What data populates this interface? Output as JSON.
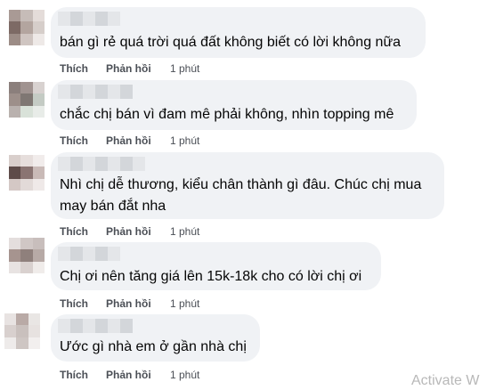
{
  "comments": [
    {
      "author_name": "",
      "text_lines": [
        "bán gì rẻ quá trời quá đất không biết có lời không nữa"
      ],
      "like_label": "Thích",
      "reply_label": "Phản hồi",
      "timestamp": "1 phút",
      "avatar_colors": [
        "#a99a95",
        "#c6bcb8",
        "#e4dcd9",
        "#7d6a65",
        "#b3a59f",
        "#d6ceca",
        "#9c8c86",
        "#cfc5c1",
        "#eee9e7"
      ]
    },
    {
      "author_name": "",
      "text_lines": [
        "chắc chị bán vì đam mê phải không, nhìn topping mê"
      ],
      "like_label": "Thích",
      "reply_label": "Phản hồi",
      "timestamp": "1 phút",
      "avatar_colors": [
        "#8b7f7c",
        "#a09390",
        "#d8d2d0",
        "#9d8f8a",
        "#7f7773",
        "#c4cbc4",
        "#b9b1ae",
        "#d9e2d9",
        "#e8ece8"
      ]
    },
    {
      "author_name": "",
      "text_lines": [
        "Nhì chị dễ thương, kiểu chân thành gì đâu. Chúc chị mua",
        "may bán đắt nha"
      ],
      "like_label": "Thích",
      "reply_label": "Phản hồi",
      "timestamp": "1 phút",
      "avatar_colors": [
        "#d9cfcc",
        "#e6dedc",
        "#f1eceb",
        "#5e4b49",
        "#8a7472",
        "#c9bab7",
        "#d4c8c5",
        "#e2dad8",
        "#efe9e8"
      ]
    },
    {
      "author_name": "",
      "text_lines": [
        "Chị ơi nên tăng giá lên 15k-18k cho có lời chị ơi"
      ],
      "like_label": "Thích",
      "reply_label": "Phản hồi",
      "timestamp": "1 phút",
      "avatar_colors": [
        "#e4dedd",
        "#d0c7c5",
        "#c8bebc",
        "#a6948f",
        "#8f807c",
        "#b7aaa6",
        "#e8e3e2",
        "#d9d1cf",
        "#f0ecea"
      ]
    },
    {
      "author_name": "",
      "text_lines": [
        "Ước gì nhà em ở gần nhà chị"
      ],
      "like_label": "Thích",
      "reply_label": "Phản hồi",
      "timestamp": "1 phút",
      "avatar_colors": [
        "#e8e3e2",
        "#b9aaa6",
        "#e9e6e4",
        "#d8d0ce",
        "#c9c0bd",
        "#e7e2e0",
        "#eeebea",
        "#cec6c3",
        "#f2efee"
      ]
    }
  ],
  "watermark": "Activate W",
  "colors": {
    "bubble": "#f0f2f5",
    "text": "#050505",
    "action": "#4b4f56",
    "name_blur_a": "#e4e6e9",
    "name_blur_b": "#d3d6da"
  }
}
